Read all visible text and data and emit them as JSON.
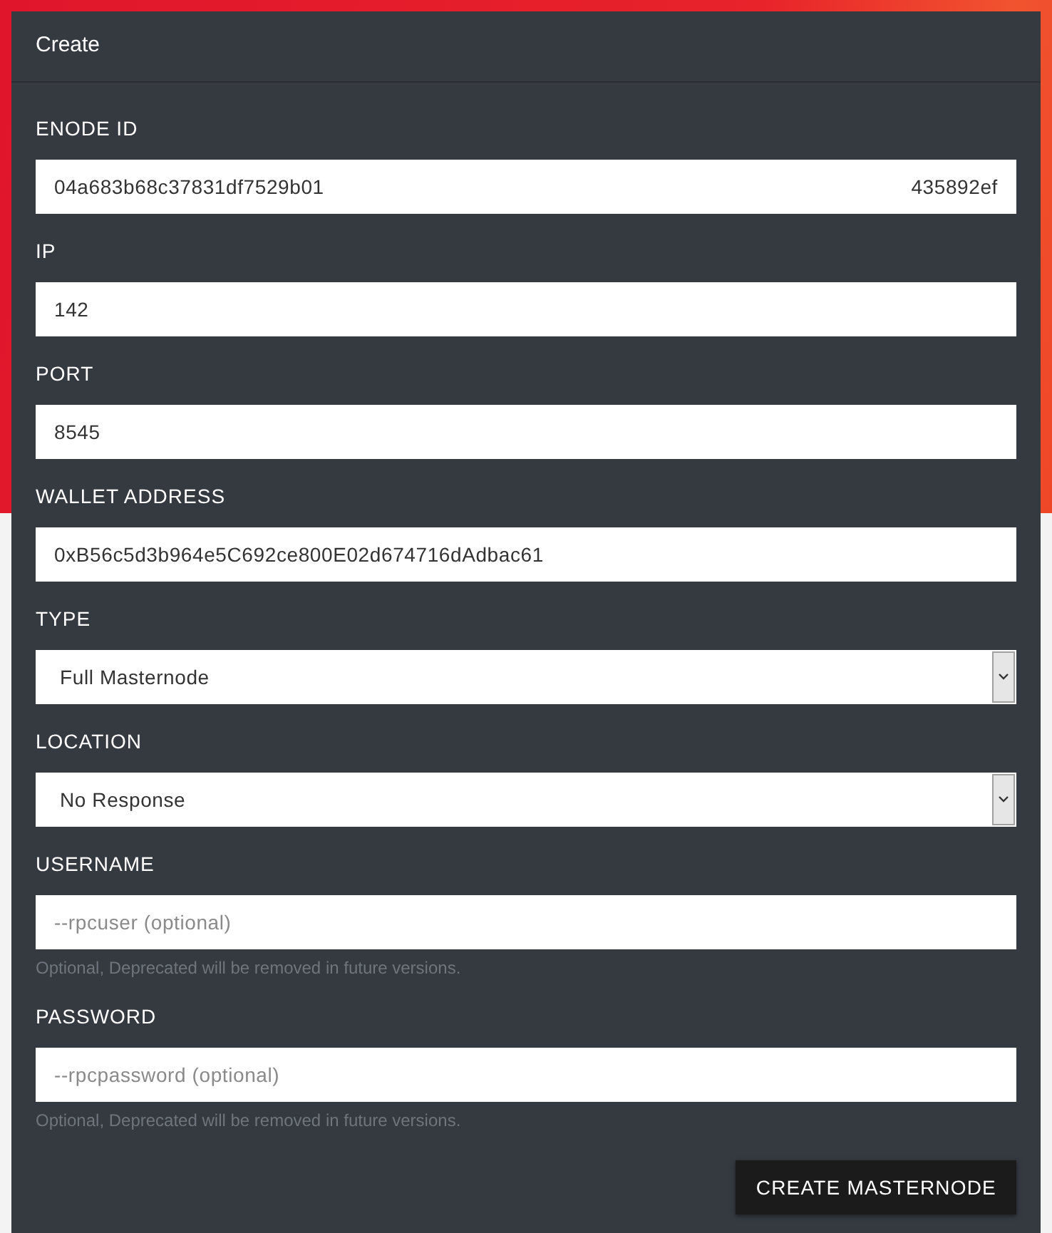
{
  "dialog": {
    "title": "Create"
  },
  "fields": [
    {
      "kind": "split",
      "label": "ENODE ID",
      "value_start": "04a683b68c37831df7529b01",
      "value_end": "435892ef"
    },
    {
      "kind": "text",
      "label": "IP",
      "value": "142"
    },
    {
      "kind": "text",
      "label": "PORT",
      "value": "8545"
    },
    {
      "kind": "text",
      "label": "WALLET ADDRESS",
      "value": "0xB56c5d3b964e5C692ce800E02d674716dAdbac61"
    },
    {
      "kind": "select",
      "label": "TYPE",
      "value": "Full Masternode"
    },
    {
      "kind": "select",
      "label": "LOCATION",
      "value": "No Response"
    },
    {
      "kind": "text",
      "label": "USERNAME",
      "placeholder": "--rpcuser (optional)",
      "hint": "Optional, Deprecated will be removed in future versions."
    },
    {
      "kind": "text",
      "label": "PASSWORD",
      "placeholder": "--rpcpassword (optional)",
      "hint": "Optional, Deprecated will be removed in future versions."
    }
  ],
  "submit_button": "CREATE MASTERNODE"
}
